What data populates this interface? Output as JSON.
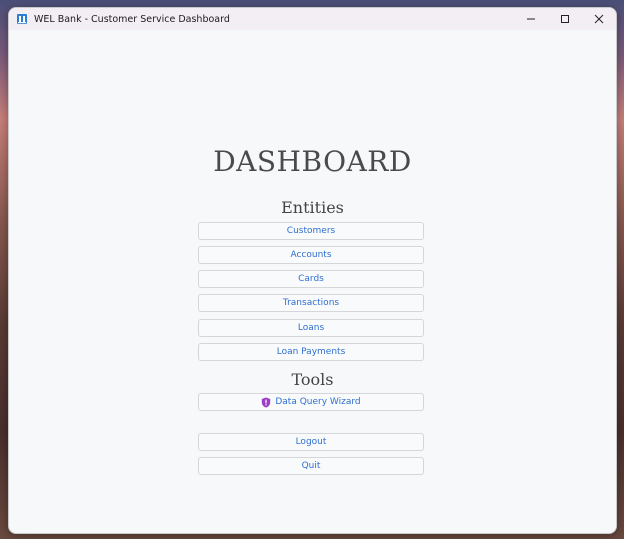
{
  "window": {
    "title": "WEL Bank - Customer Service Dashboard"
  },
  "main": {
    "heading": "DASHBOARD",
    "entities_title": "Entities",
    "entities": [
      {
        "label": "Customers"
      },
      {
        "label": "Accounts"
      },
      {
        "label": "Cards"
      },
      {
        "label": "Transactions"
      },
      {
        "label": "Loans"
      },
      {
        "label": "Loan Payments"
      }
    ],
    "tools_title": "Tools",
    "tools": [
      {
        "label": "Data Query Wizard",
        "icon": "shield-icon"
      }
    ],
    "session": [
      {
        "label": "Logout"
      },
      {
        "label": "Quit"
      }
    ]
  },
  "colors": {
    "link": "#2f6fcf",
    "heading": "#4a4a4a",
    "shield": "#9b3fc4"
  }
}
